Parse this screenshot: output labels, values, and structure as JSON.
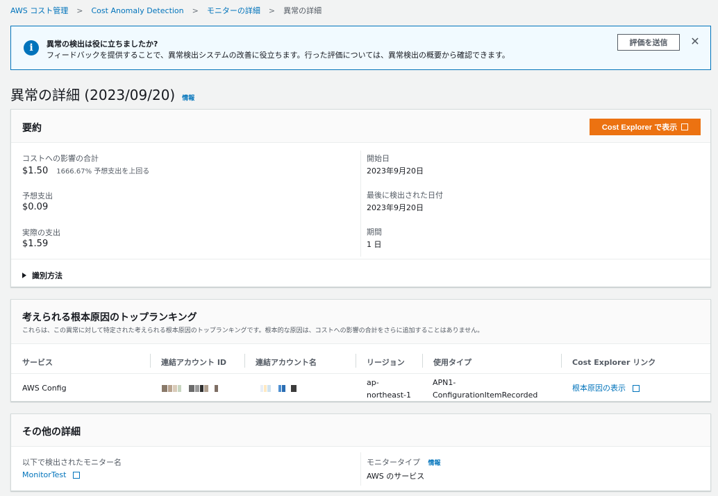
{
  "breadcrumb": {
    "items": [
      "AWS コスト管理",
      "Cost Anomaly Detection",
      "モニターの詳細",
      "異常の詳細"
    ]
  },
  "flash": {
    "title": "異常の検出は役に立ちましたか?",
    "message": "フィードバックを提供することで、異常検出システムの改善に役立ちます。行った評価については、異常検出の概要から確認できます。",
    "button_label": "評価を送信",
    "close_glyph": "✕",
    "info_glyph": "i",
    "accent": "#0073bb"
  },
  "page": {
    "title": "異常の詳細 (2023/09/20)",
    "info_link": "情報"
  },
  "summary": {
    "heading": "要約",
    "ce_button_label": "Cost Explorer で表示",
    "total_impact_label": "コストへの影響の合計",
    "total_impact_value": "$1.50",
    "total_impact_sub": "1666.67% 予想支出を上回る",
    "expected_label": "予想支出",
    "expected_value": "$0.09",
    "actual_label": "実際の支出",
    "actual_value": "$1.59",
    "start_label": "開始日",
    "start_value": "2023年9月20日",
    "last_detected_label": "最後に検出された日付",
    "last_detected_value": "2023年9月20日",
    "duration_label": "期間",
    "duration_value": "1 日",
    "expander_label": "識別方法",
    "button_color": "#ec7211"
  },
  "causes": {
    "heading": "考えられる根本原因のトップランキング",
    "description": "これらは、この異常に対して特定された考えられる根本原因のトップランキングです。根本的な原因は、コストへの影響の合計をさらに追加することはありません。",
    "columns": [
      "サービス",
      "連結アカウント ID",
      "連結アカウント名",
      "リージョン",
      "使用タイプ",
      "Cost Explorer リンク"
    ],
    "rows": [
      {
        "service": "AWS Config",
        "region_line1": "ap-",
        "region_line2": "northeast-1",
        "usage_line1": "APN1-",
        "usage_line2": "ConfigurationItemRecorded",
        "link": "根本原因の表示"
      }
    ]
  },
  "other": {
    "heading": "その他の詳細",
    "monitor_label": "以下で検出されたモニター名",
    "monitor_value": "MonitorTest",
    "monitor_type_label": "モニタータイプ",
    "monitor_type_info": "情報",
    "monitor_type_value": "AWS のサービス"
  }
}
